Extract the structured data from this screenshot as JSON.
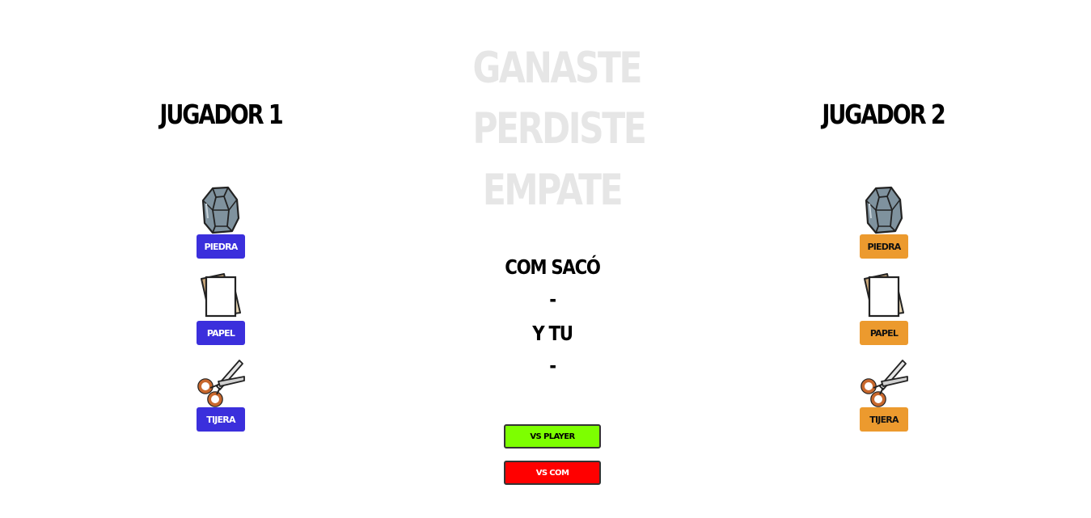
{
  "player1": {
    "title": "JUGADOR 1",
    "choices": [
      {
        "label": "PIEDRA",
        "icon": "rock-icon"
      },
      {
        "label": "PAPEL",
        "icon": "paper-icon"
      },
      {
        "label": "TIJERA",
        "icon": "scissors-icon"
      }
    ],
    "button_color": "#3b2fdc"
  },
  "player2": {
    "title": "JUGADOR 2",
    "choices": [
      {
        "label": "PIEDRA",
        "icon": "rock-icon"
      },
      {
        "label": "PAPEL",
        "icon": "paper-icon"
      },
      {
        "label": "TIJERA",
        "icon": "scissors-icon"
      }
    ],
    "button_color": "#ec9a2e"
  },
  "results": {
    "win": "GANASTE",
    "lose": "PERDISTE",
    "draw": "EMPATE"
  },
  "status": {
    "com_label": "COM SACÓ",
    "com_value": "-",
    "you_label": "Y TU",
    "you_value": "-"
  },
  "modes": {
    "vs_player": "VS PLAYER",
    "vs_com": "VS COM",
    "vs_player_color": "#7dff00",
    "vs_com_color": "#ff0000"
  }
}
